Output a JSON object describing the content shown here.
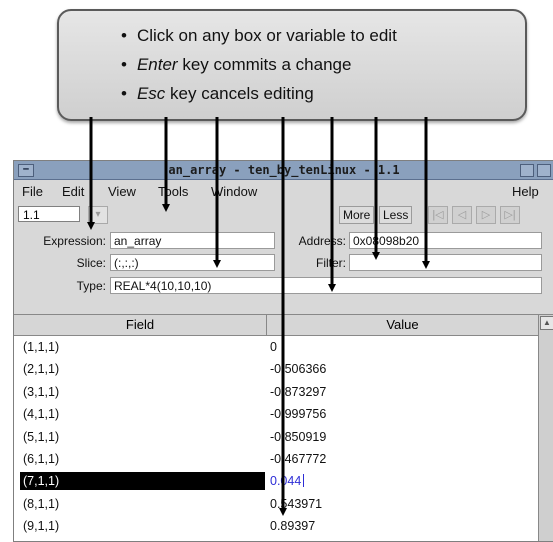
{
  "callout": {
    "line1": "Click on any box or variable to edit",
    "line2_em": "Enter",
    "line2_rest": " key commits a change",
    "line3_em": "Esc",
    "line3_rest": " key cancels editing"
  },
  "window": {
    "title": "an_array - ten_by_tenLinux - 1.1",
    "menu": [
      "File",
      "Edit",
      "View",
      "Tools",
      "Window",
      "Help"
    ],
    "scope_value": "1.1",
    "more_label": "More",
    "less_label": "Less"
  },
  "form": {
    "expression_label": "Expression:",
    "expression_value": "an_array",
    "address_label": "Address:",
    "address_value": "0x08098b20",
    "slice_label": "Slice:",
    "slice_value": "(:,:,:)",
    "filter_label": "Filter:",
    "filter_value": "",
    "type_label": "Type:",
    "type_value": "REAL*4(10,10,10)"
  },
  "table": {
    "field_header": "Field",
    "value_header": "Value",
    "rows": [
      {
        "field": "(1,1,1)",
        "value": "0"
      },
      {
        "field": "(2,1,1)",
        "value": "-0.506366"
      },
      {
        "field": "(3,1,1)",
        "value": "-0.873297"
      },
      {
        "field": "(4,1,1)",
        "value": "-0.999756"
      },
      {
        "field": "(5,1,1)",
        "value": "-0.850919"
      },
      {
        "field": "(6,1,1)",
        "value": "-0.467772"
      },
      {
        "field": "(7,1,1)",
        "value": "0.044"
      },
      {
        "field": "(8,1,1)",
        "value": "0.543971"
      },
      {
        "field": "(9,1,1)",
        "value": "0.89397"
      }
    ]
  },
  "colors": {
    "selected_row_bg": "#000000",
    "edit_text": "#2d2dd6",
    "titlebar": "#8aa0bd"
  }
}
